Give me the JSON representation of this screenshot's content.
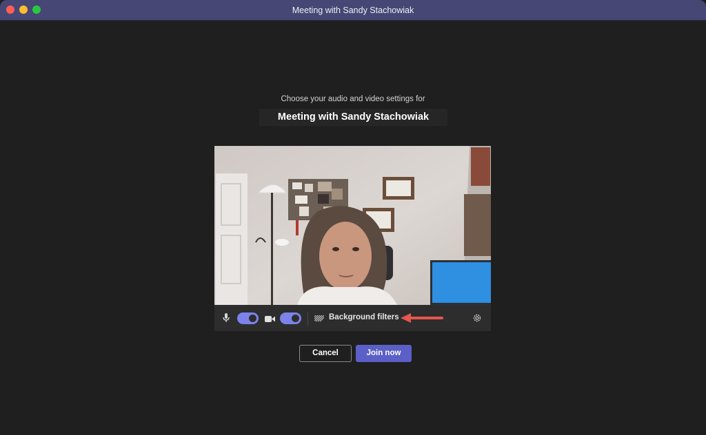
{
  "window": {
    "title": "Meeting with Sandy Stachowiak"
  },
  "prejoin": {
    "subtitle": "Choose your audio and video settings for",
    "meeting_title": "Meeting with Sandy Stachowiak"
  },
  "controls": {
    "mic_icon": "microphone-icon",
    "mic_on": true,
    "camera_icon": "video-camera-icon",
    "camera_on": true,
    "background_filters_label": "Background filters",
    "background_icon": "background-blur-icon",
    "settings_icon": "gear-icon",
    "annotation": "red-arrow-pointing-left"
  },
  "buttons": {
    "cancel_label": "Cancel",
    "join_label": "Join now"
  },
  "colors": {
    "titlebar": "#464775",
    "background": "#1f1f1f",
    "accent": "#7b83eb",
    "join_button": "#5b5fc7",
    "annotation_arrow": "#e8564e"
  }
}
